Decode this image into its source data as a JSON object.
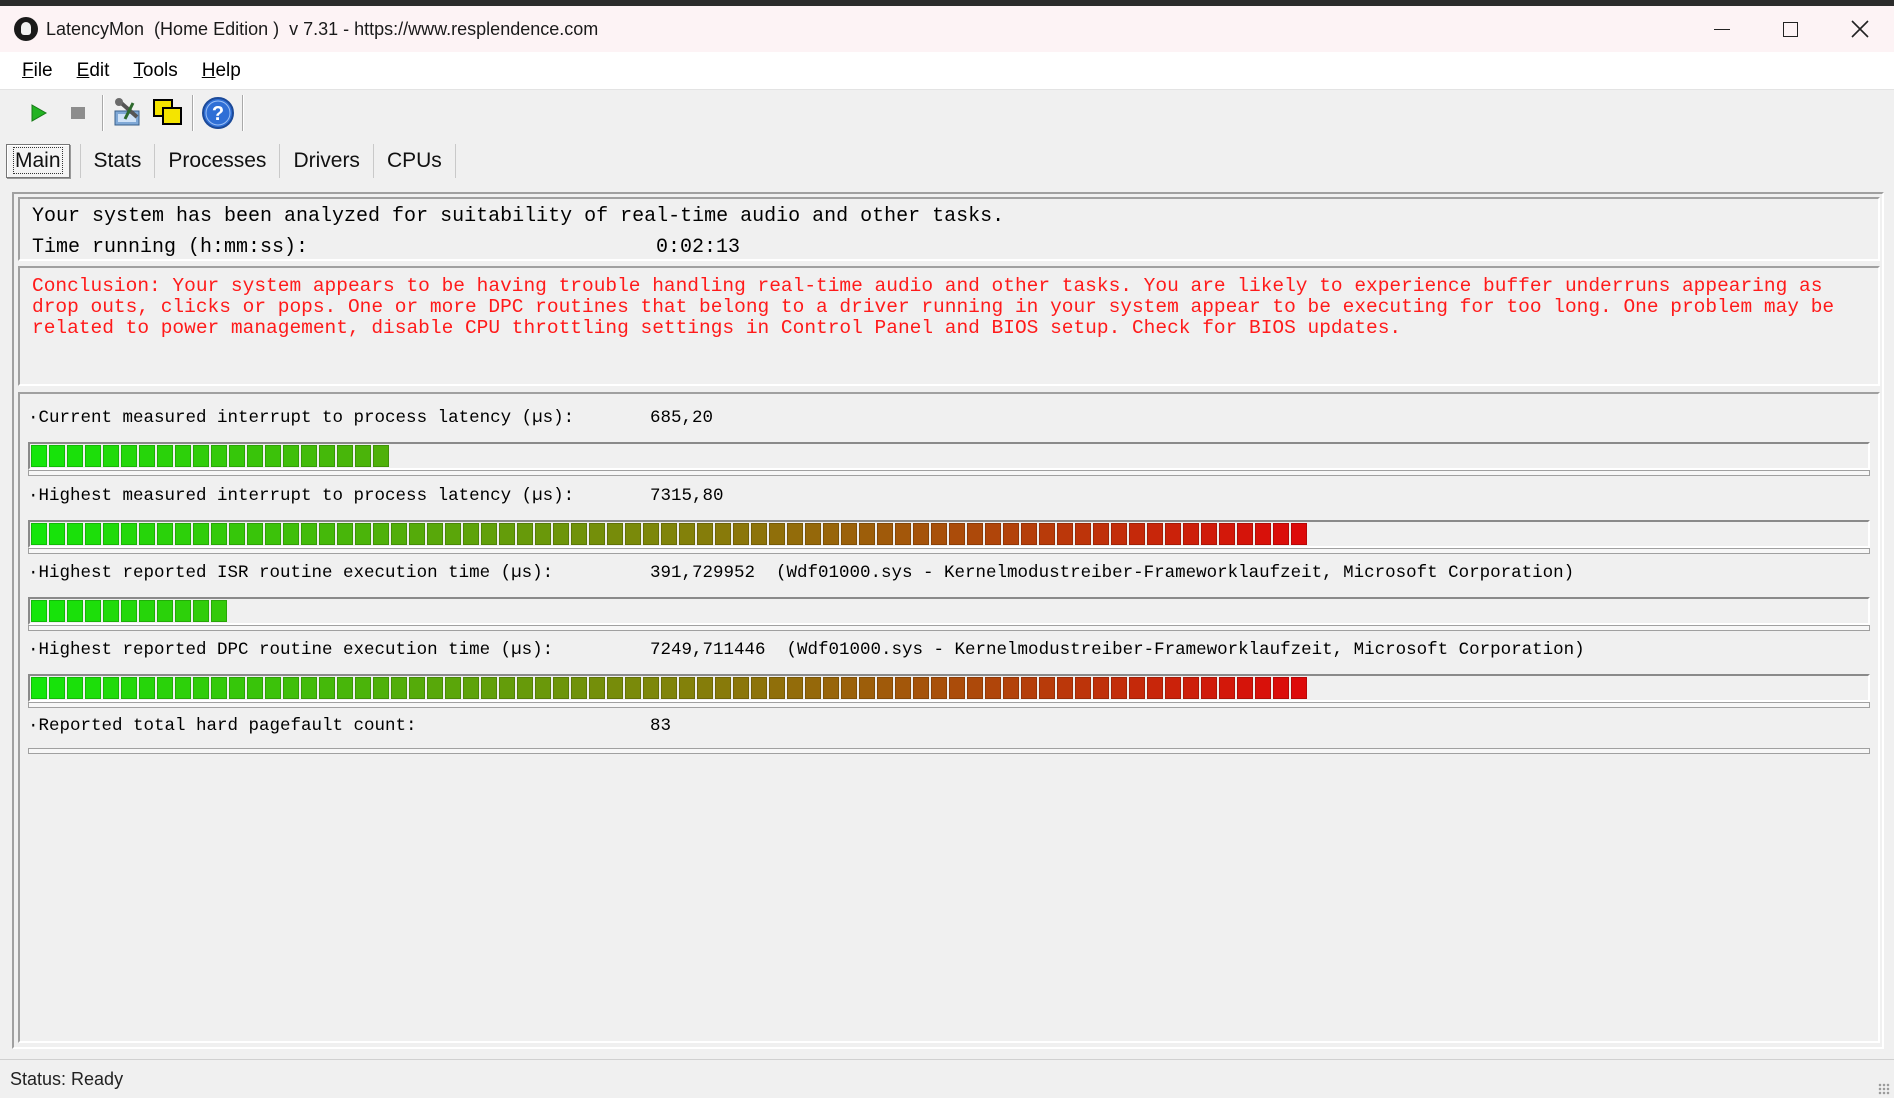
{
  "window": {
    "title": "LatencyMon  (Home Edition )  v 7.31 - https://www.resplendence.com",
    "icon": "latencymon-app-icon"
  },
  "menu": {
    "items": [
      {
        "label": "File",
        "accel": "F",
        "rest": "ile"
      },
      {
        "label": "Edit",
        "accel": "E",
        "rest": "dit"
      },
      {
        "label": "Tools",
        "accel": "T",
        "rest": "ools"
      },
      {
        "label": "Help",
        "accel": "H",
        "rest": "elp"
      }
    ]
  },
  "toolbar": {
    "buttons": [
      "play-icon",
      "stop-icon",
      "tools-icon",
      "windows-icon",
      "help-icon"
    ]
  },
  "tabs": [
    {
      "label": "Main",
      "active": true
    },
    {
      "label": "Stats",
      "active": false
    },
    {
      "label": "Processes",
      "active": false
    },
    {
      "label": "Drivers",
      "active": false
    },
    {
      "label": "CPUs",
      "active": false
    }
  ],
  "info": {
    "analyzed": "Your system has been analyzed for suitability of real-time audio and other tasks.",
    "time_label": "Time running (h:mm:ss):",
    "time_value": "0:02:13"
  },
  "conclusion": {
    "text": "Conclusion: Your system appears to be having trouble handling real-time audio and other tasks. You are likely to experience buffer underruns appearing as drop outs, clicks or pops. One or more DPC routines that belong to a driver running in your system appear to be executing for too long. One problem may be related to power management, disable CPU throttling settings in Control Panel and BIOS setup. Check for BIOS updates.",
    "color": "#ff1a1a"
  },
  "metrics": [
    {
      "label": "·Current measured interrupt to process latency (µs):",
      "value": "685,20",
      "meter_level": 0.2
    },
    {
      "label": "·Highest measured interrupt to process latency (µs):",
      "value": "7315,80",
      "meter_level": 0.7
    },
    {
      "label": "·Highest reported ISR routine execution time (µs):",
      "value": "391,729952  (Wdf01000.sys - Kernelmodustreiber-Frameworklaufzeit, Microsoft Corporation)",
      "meter_level": 0.106
    },
    {
      "label": "·Highest reported DPC routine execution time (µs):",
      "value": "7249,711446  (Wdf01000.sys - Kernelmodustreiber-Frameworklaufzeit, Microsoft Corporation)",
      "meter_level": 0.7
    },
    {
      "label": "·Reported total hard pagefault count:",
      "value": "83",
      "meter_level": 0
    }
  ],
  "status": {
    "text": "Status: Ready"
  }
}
